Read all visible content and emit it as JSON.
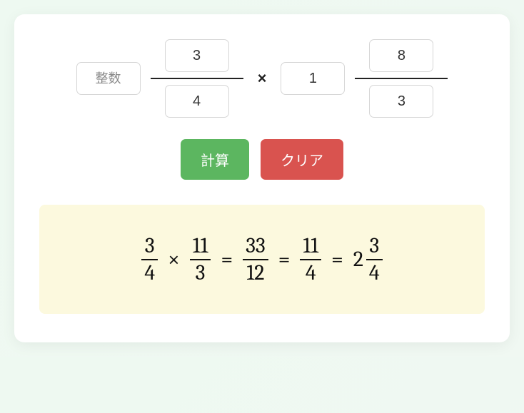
{
  "input": {
    "fraction1": {
      "whole_placeholder": "整数",
      "whole": "",
      "numerator": "3",
      "denominator": "4"
    },
    "operator": "×",
    "fraction2": {
      "whole_placeholder": "整数",
      "whole": "1",
      "numerator": "8",
      "denominator": "3"
    }
  },
  "buttons": {
    "calculate": "計算",
    "clear": "クリア"
  },
  "result": {
    "steps": [
      {
        "type": "frac",
        "num": "3",
        "den": "4"
      },
      {
        "type": "sym",
        "text": "×"
      },
      {
        "type": "frac",
        "num": "11",
        "den": "3"
      },
      {
        "type": "sym",
        "text": "="
      },
      {
        "type": "frac",
        "num": "33",
        "den": "12"
      },
      {
        "type": "sym",
        "text": "="
      },
      {
        "type": "frac",
        "num": "11",
        "den": "4"
      },
      {
        "type": "sym",
        "text": "="
      },
      {
        "type": "mixed",
        "whole": "2",
        "num": "3",
        "den": "4"
      }
    ]
  }
}
